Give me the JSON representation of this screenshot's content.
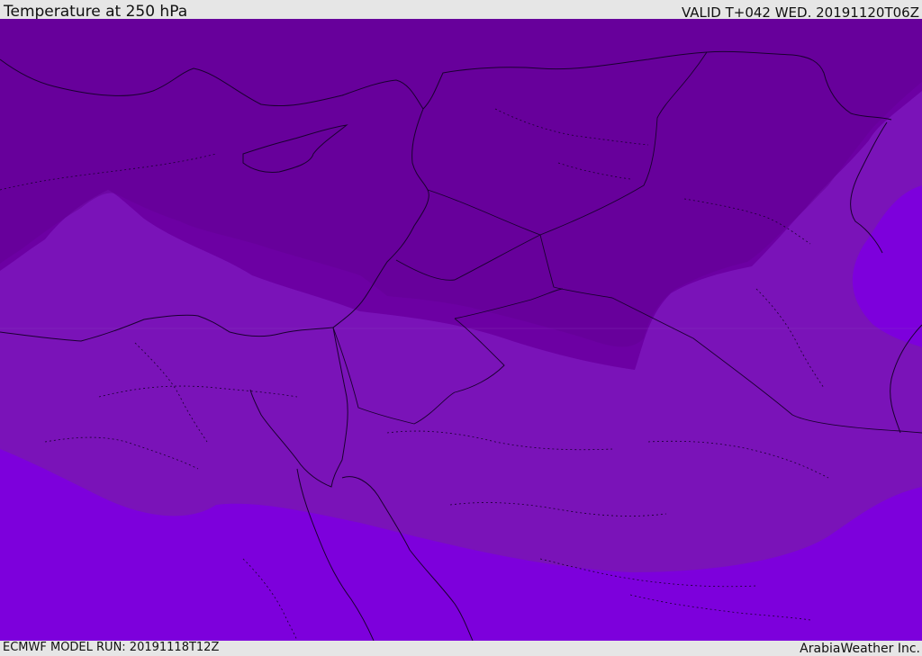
{
  "header": {
    "title": "Temperature at 250 hPa",
    "valid": "VALID T+042 WED. 20191120T06Z"
  },
  "footer": {
    "model_run": "ECMWF MODEL RUN: 20191118T12Z",
    "credit": "ArabiaWeather Inc."
  },
  "map": {
    "colors": {
      "coldest": "#640096",
      "cold": "#6c00a3",
      "mid": "#7a13b8",
      "warm": "#7d00dc"
    }
  }
}
